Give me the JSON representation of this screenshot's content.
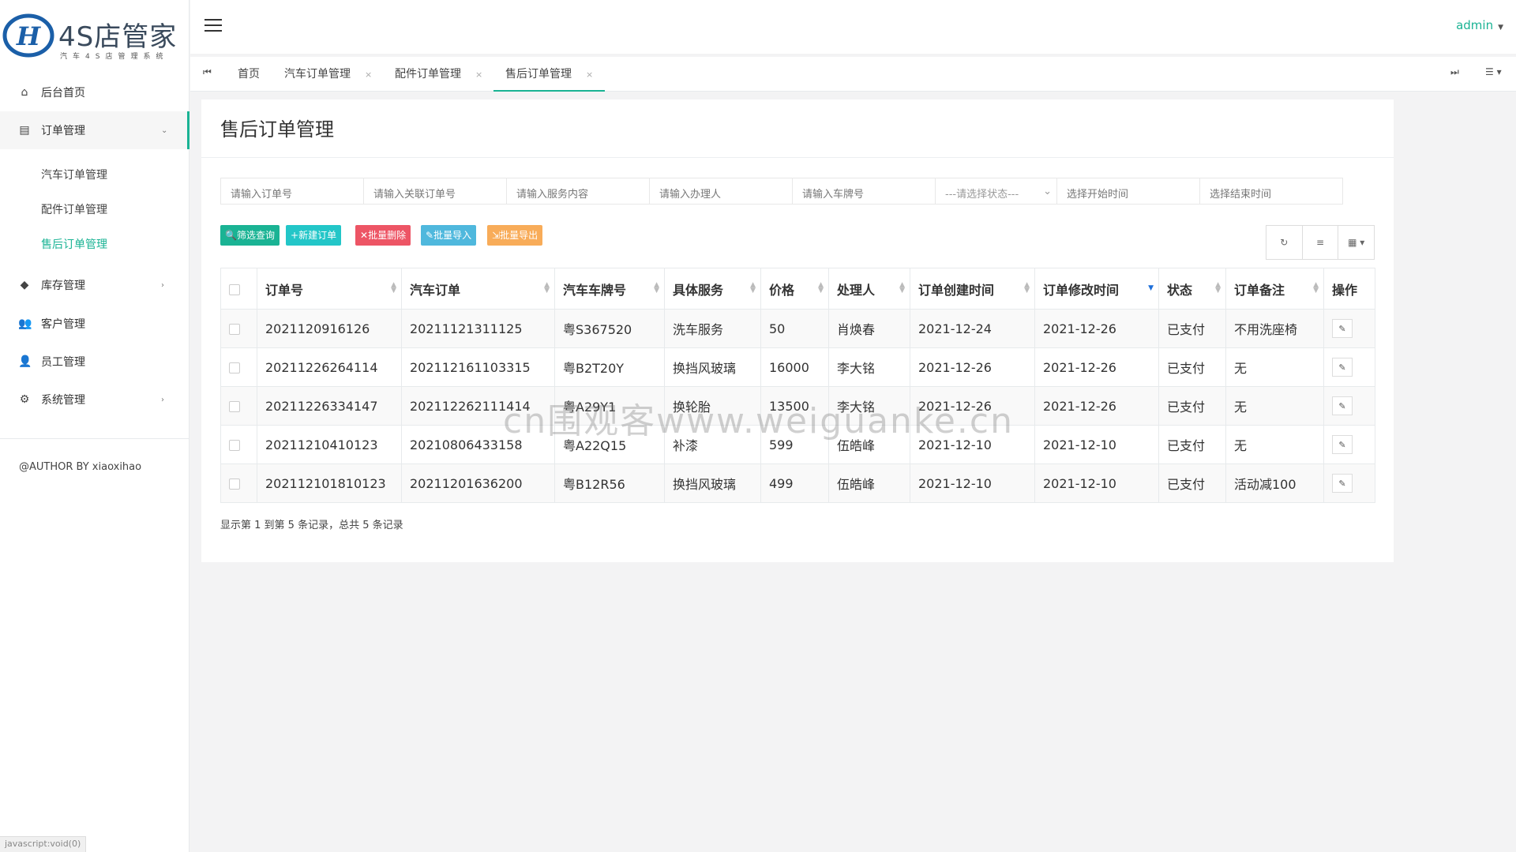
{
  "brand": {
    "title": "4S店管家",
    "subtitle": "汽车4S店管理系统"
  },
  "sidebar": {
    "items": [
      {
        "label": "后台首页",
        "icon": "home-icon"
      },
      {
        "label": "订单管理",
        "icon": "clipboard-icon"
      },
      {
        "label": "库存管理",
        "icon": "cube-icon"
      },
      {
        "label": "客户管理",
        "icon": "users-icon"
      },
      {
        "label": "员工管理",
        "icon": "user-icon"
      },
      {
        "label": "系统管理",
        "icon": "gear-icon"
      }
    ],
    "sub_items": [
      "汽车订单管理",
      "配件订单管理",
      "售后订单管理"
    ],
    "author": "@AUTHOR BY xiaoxihao",
    "status_url": "javascript:void(0)"
  },
  "header": {
    "user": "admin"
  },
  "tabs": [
    {
      "label": "首页"
    },
    {
      "label": "汽车订单管理"
    },
    {
      "label": "配件订单管理"
    },
    {
      "label": "售后订单管理"
    }
  ],
  "page": {
    "title": "售后订单管理"
  },
  "filters": {
    "order_no": "请输入订单号",
    "related_order": "请输入关联订单号",
    "service": "请输入服务内容",
    "handler": "请输入办理人",
    "plate": "请输入车牌号",
    "status": "---请选择状态---",
    "start": "选择开始时间",
    "end": "选择结束时间"
  },
  "actions": {
    "query": "筛选查询",
    "add": "新建订单",
    "batch_delete": "批量删除",
    "batch_import": "批量导入",
    "batch_export": "批量导出"
  },
  "table": {
    "headers": [
      "订单号",
      "汽车订单",
      "汽车车牌号",
      "具体服务",
      "价格",
      "处理人",
      "订单创建时间",
      "订单修改时间",
      "状态",
      "订单备注",
      "操作"
    ],
    "rows": [
      [
        "2021120916126",
        "20211121311125",
        "粤S367520",
        "洗车服务",
        "50",
        "肖焕春",
        "2021-12-24",
        "2021-12-26",
        "已支付",
        "不用洗座椅"
      ],
      [
        "20211226264114",
        "202112161103315",
        "粤B2T20Y",
        "换挡风玻璃",
        "16000",
        "李大铭",
        "2021-12-26",
        "2021-12-26",
        "已支付",
        "无"
      ],
      [
        "20211226334147",
        "202112262111414",
        "粤A29Y1",
        "换轮胎",
        "13500",
        "李大铭",
        "2021-12-26",
        "2021-12-26",
        "已支付",
        "无"
      ],
      [
        "20211210410123",
        "20210806433158",
        "粤A22Q15",
        "补漆",
        "599",
        "伍皓峰",
        "2021-12-10",
        "2021-12-10",
        "已支付",
        "无"
      ],
      [
        "202112101810123",
        "20211201636200",
        "粤B12R56",
        "换挡风玻璃",
        "499",
        "伍皓峰",
        "2021-12-10",
        "2021-12-10",
        "已支付",
        "活动减100"
      ]
    ]
  },
  "pagination_info": "显示第 1 到第 5 条记录，总共 5 条记录",
  "watermark": "cn围观客www.weiguanke.cn",
  "colors": {
    "accent": "#1ab394",
    "danger": "#ed5565",
    "info": "#4fb8dd",
    "warning": "#f8ac59",
    "teal": "#23c6c8"
  }
}
